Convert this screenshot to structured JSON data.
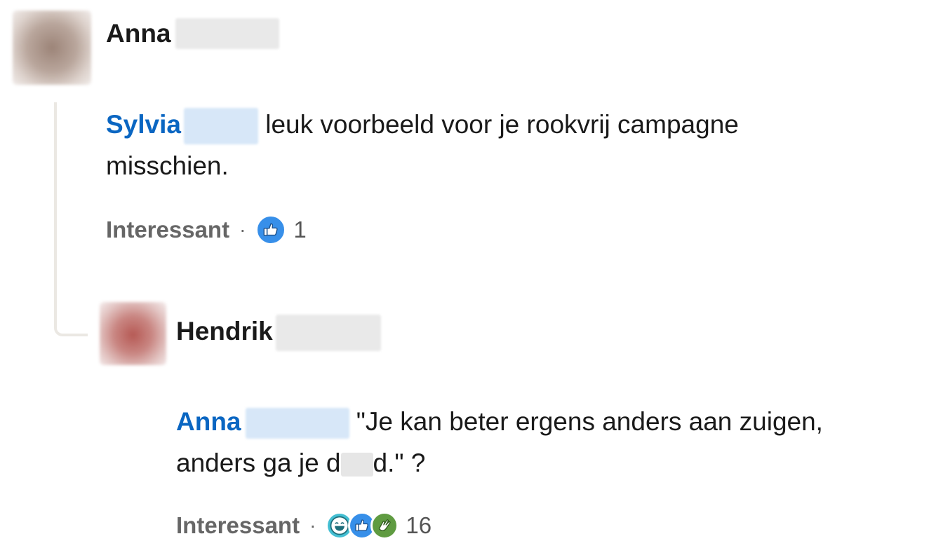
{
  "comment1": {
    "author_first": "Anna",
    "mention_name": "Sylvia",
    "text_line1": " leuk voorbeeld voor je rookvrij campagne",
    "text_line2": "misschien.",
    "action_label": "Interessant",
    "separator": "·",
    "reactions": [
      "like-icon"
    ],
    "reaction_count": "1"
  },
  "comment2": {
    "author_first": "Hendrik",
    "mention_name": "Anna",
    "text_line1": " \"Je kan beter ergens anders aan zuigen,",
    "text_line2_a": "anders ga je d",
    "text_line2_b": "d.\" ?",
    "action_label": "Interessant",
    "separator": "·",
    "reactions": [
      "funny-icon",
      "like-icon",
      "celebrate-icon"
    ],
    "reaction_count": "16"
  },
  "colors": {
    "mention": "#0a66c2",
    "like": "#378fe9",
    "funny": "#44bfd3",
    "celebrate": "#5f9b41"
  }
}
